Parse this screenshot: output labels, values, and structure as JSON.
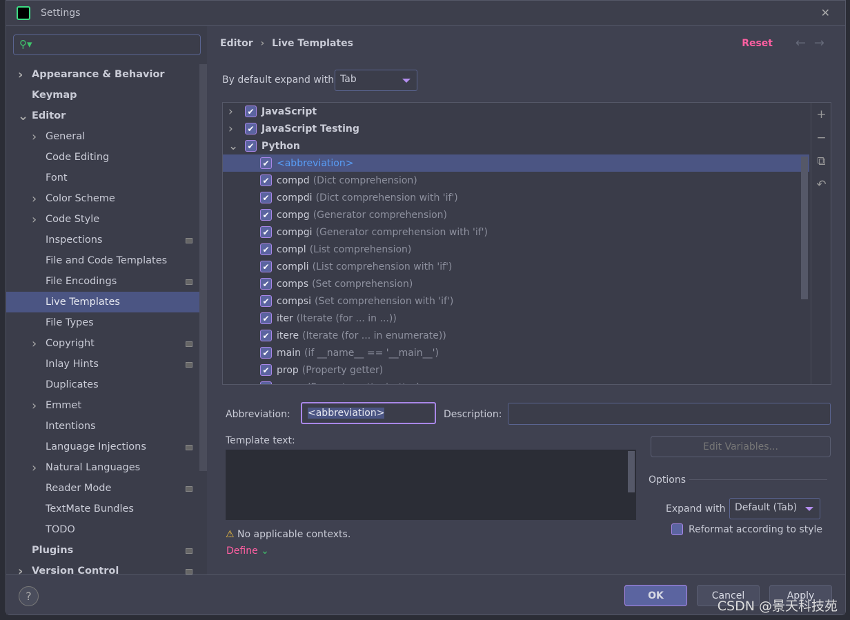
{
  "window": {
    "title": "Settings",
    "logo": "PC"
  },
  "sidebar": {
    "items": [
      {
        "label": "Appearance & Behavior",
        "bold": true,
        "chev": "right",
        "level": 0
      },
      {
        "label": "Keymap",
        "bold": true,
        "level": 0
      },
      {
        "label": "Editor",
        "bold": true,
        "chev": "down",
        "level": 0
      },
      {
        "label": "General",
        "chev": "right",
        "level": 1
      },
      {
        "label": "Code Editing",
        "level": 1
      },
      {
        "label": "Font",
        "level": 1
      },
      {
        "label": "Color Scheme",
        "chev": "right",
        "level": 1
      },
      {
        "label": "Code Style",
        "chev": "right",
        "level": 1
      },
      {
        "label": "Inspections",
        "level": 1,
        "badge": true
      },
      {
        "label": "File and Code Templates",
        "level": 1
      },
      {
        "label": "File Encodings",
        "level": 1,
        "badge": true
      },
      {
        "label": "Live Templates",
        "level": 1,
        "selected": true
      },
      {
        "label": "File Types",
        "level": 1
      },
      {
        "label": "Copyright",
        "chev": "right",
        "level": 1,
        "badge": true
      },
      {
        "label": "Inlay Hints",
        "level": 1,
        "badge": true
      },
      {
        "label": "Duplicates",
        "level": 1
      },
      {
        "label": "Emmet",
        "chev": "right",
        "level": 1
      },
      {
        "label": "Intentions",
        "level": 1
      },
      {
        "label": "Language Injections",
        "level": 1,
        "badge": true
      },
      {
        "label": "Natural Languages",
        "chev": "right",
        "level": 1
      },
      {
        "label": "Reader Mode",
        "level": 1,
        "badge": true
      },
      {
        "label": "TextMate Bundles",
        "level": 1
      },
      {
        "label": "TODO",
        "level": 1
      },
      {
        "label": "Plugins",
        "bold": true,
        "level": 0,
        "badge": true
      },
      {
        "label": "Version Control",
        "bold": true,
        "chev": "right",
        "level": 0,
        "badge": true
      }
    ]
  },
  "header": {
    "breadcrumb": [
      "Editor",
      "Live Templates"
    ],
    "separator": "›",
    "reset": "Reset"
  },
  "expand_default": {
    "label": "By default expand with",
    "value": "Tab"
  },
  "tree": {
    "groups": [
      {
        "label": "JavaScript",
        "expanded": false
      },
      {
        "label": "JavaScript Testing",
        "expanded": false
      },
      {
        "label": "Python",
        "expanded": true
      }
    ],
    "templates": [
      {
        "abbr": "<abbreviation>",
        "desc": "",
        "selected": true
      },
      {
        "abbr": "compd",
        "desc": "(Dict comprehension)"
      },
      {
        "abbr": "compdi",
        "desc": "(Dict comprehension with 'if')"
      },
      {
        "abbr": "compg",
        "desc": "(Generator comprehension)"
      },
      {
        "abbr": "compgi",
        "desc": "(Generator comprehension with 'if')"
      },
      {
        "abbr": "compl",
        "desc": "(List comprehension)"
      },
      {
        "abbr": "compli",
        "desc": "(List comprehension with 'if')"
      },
      {
        "abbr": "comps",
        "desc": "(Set comprehension)"
      },
      {
        "abbr": "compsi",
        "desc": "(Set comprehension with 'if')"
      },
      {
        "abbr": "iter",
        "desc": "(Iterate (for ... in ...))"
      },
      {
        "abbr": "itere",
        "desc": "(Iterate (for ... in enumerate))"
      },
      {
        "abbr": "main",
        "desc": "(if __name__ == '__main__')"
      },
      {
        "abbr": "prop",
        "desc": "(Property getter)"
      },
      {
        "abbr": "props",
        "desc": "(Property getter/setter)"
      }
    ]
  },
  "editor": {
    "abbreviation_label": "Abbreviation:",
    "abbreviation_value": "<abbreviation>",
    "description_label": "Description:",
    "description_value": "",
    "template_label": "Template text:",
    "edit_variables": "Edit Variables...",
    "warning": "No applicable contexts.",
    "define": "Define",
    "options": "Options",
    "expand_label": "Expand with",
    "expand_value": "Default (Tab)",
    "reformat": "Reformat according to style",
    "reformat_checked": false
  },
  "footer": {
    "ok": "OK",
    "cancel": "Cancel",
    "apply": "Apply",
    "help": "?"
  },
  "watermark": "CSDN @景天科技苑",
  "colors": {
    "accent": "#a987e8",
    "reset": "#ff5fa2",
    "selection": "#4b5583",
    "link": "#589df6"
  }
}
